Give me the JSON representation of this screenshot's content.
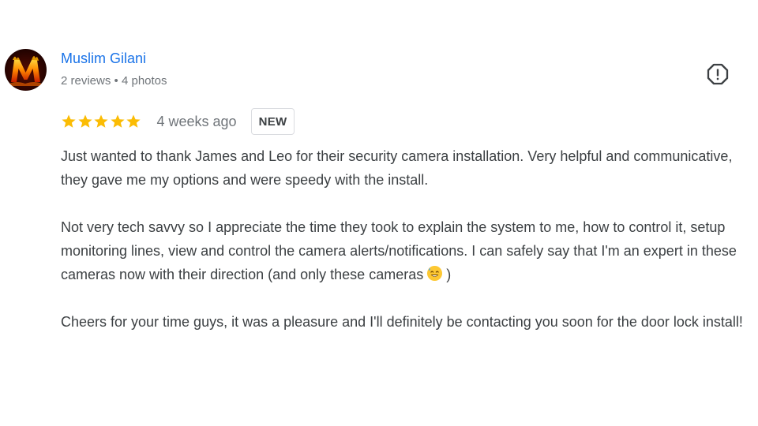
{
  "review": {
    "author": {
      "name": "Muslim Gilani",
      "reviews": "2 reviews",
      "separator": "•",
      "photos": "4 photos",
      "avatar_icon": "flaming-letter-m-avatar"
    },
    "rating": {
      "stars": 5,
      "max_stars": 5,
      "star_color": "#fbbc04"
    },
    "date": "4 weeks ago",
    "badge": "NEW",
    "flag_icon": "report-exclamation-icon",
    "text": {
      "p1": "Just wanted to thank James and Leo for their security camera installation. Very helpful and communicative, they gave me my options and were speedy with the install.",
      "p2_before_emoji": "Not very tech savvy so I appreciate the time they took to explain the system to me, how to control it, setup monitoring lines, view and control the camera alerts/notifications. I can safely say that I'm an expert in these cameras now with their direction (and only these cameras",
      "p2_emoji": "smiling-face-with-sweat-icon",
      "p2_after_emoji": ")",
      "p3": "Cheers for your time guys, it was a pleasure and I'll definitely be contacting you soon for the door lock install!"
    },
    "colors": {
      "author_link": "#1a73e8",
      "secondary_text": "#70757a",
      "body_text": "#3c4043"
    }
  }
}
